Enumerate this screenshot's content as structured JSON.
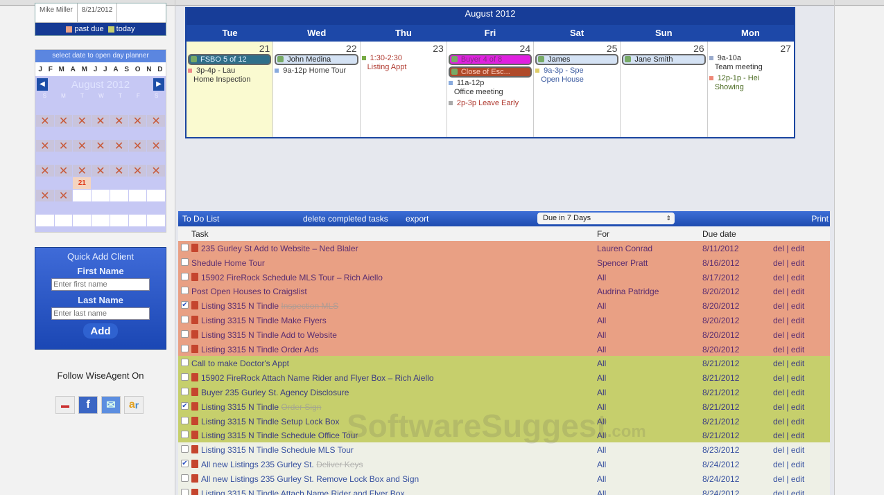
{
  "top_legend": {
    "user": "Mike Miller",
    "date": "8/21/2012",
    "past_due": "past due",
    "today": "today"
  },
  "mini_calendar": {
    "header": "select date to open day planner",
    "months": [
      "J",
      "F",
      "M",
      "A",
      "M",
      "J",
      "J",
      "A",
      "S",
      "O",
      "N",
      "D"
    ],
    "title": "August 2012",
    "dow": [
      "S",
      "M",
      "T",
      "W",
      "T",
      "F",
      "S"
    ],
    "today": "21"
  },
  "quick_add": {
    "title": "Quick Add Client",
    "first_label": "First Name",
    "first_placeholder": "Enter first name",
    "last_label": "Last Name",
    "last_placeholder": "Enter last name",
    "add": "Add"
  },
  "follow": {
    "label": "Follow WiseAgent On",
    "icons": [
      "youtube-icon",
      "facebook-icon",
      "twitter-icon",
      "activerain-icon"
    ]
  },
  "calendar": {
    "title": "August 2012",
    "days": [
      {
        "name": "Tue",
        "num": "21",
        "today": true,
        "pills": [
          {
            "text": "FSBO 5 of 12",
            "bg": "#2f6f8a",
            "fg": "#e0f0ff"
          }
        ],
        "events": [
          {
            "time": "3p-4p - Lau",
            "desc": "Home Inspection",
            "color": "#e88"
          }
        ]
      },
      {
        "name": "Wed",
        "num": "22",
        "pills": [
          {
            "text": "John Medina",
            "bg": "#d4e2f4",
            "fg": "#222"
          }
        ],
        "events": [
          {
            "time": "9a-12p Home Tour",
            "desc": "",
            "color": "#8ad"
          }
        ]
      },
      {
        "name": "Thu",
        "num": "23",
        "pills": [],
        "events": [
          {
            "time": "1:30-2:30",
            "desc": "Listing Appt",
            "color": "#7a4",
            "red": true
          }
        ]
      },
      {
        "name": "Fri",
        "num": "24",
        "pills": [
          {
            "text": "Buyer 4 of 8",
            "bg": "#e020e0",
            "fg": "#803080"
          },
          {
            "text": "Close of Esc...",
            "bg": "#b04a2a",
            "fg": "#ffd0c0"
          }
        ],
        "events": [
          {
            "time": "11a-12p",
            "desc": "Office meeting",
            "color": "#8ad"
          },
          {
            "time": "2p-3p Leave Early",
            "desc": "",
            "color": "#aaa",
            "red": true
          }
        ]
      },
      {
        "name": "Sat",
        "num": "25",
        "pills": [
          {
            "text": "James",
            "bg": "#d4e2f4",
            "fg": "#222"
          }
        ],
        "events": [
          {
            "time": "9a-3p - Spe",
            "desc": "Open House",
            "color": "#dc6",
            "blue": true
          }
        ]
      },
      {
        "name": "Sun",
        "num": "26",
        "pills": [
          {
            "text": "Jane Smith",
            "bg": "#d4e2f4",
            "fg": "#222"
          }
        ],
        "events": []
      },
      {
        "name": "Mon",
        "num": "27",
        "pills": [],
        "events": [
          {
            "time": "9a-10a",
            "desc": "Team meeting",
            "color": "#9ac"
          },
          {
            "time": "12p-1p - Hei",
            "desc": "Showing",
            "color": "#e87",
            "green": true
          }
        ]
      }
    ]
  },
  "todo": {
    "title": "To Do List",
    "delete_completed": "delete completed tasks",
    "export": "export",
    "filter": "Due in 7 Days",
    "print": "Print",
    "columns": {
      "task": "Task",
      "for": "For",
      "due": "Due date"
    },
    "del": "del",
    "edit": "edit",
    "rows": [
      {
        "c": "o",
        "task": "235 Gurley St Add to Website – Ned Blaler",
        "for": "Lauren Conrad",
        "due": "8/11/2012",
        "icon": true
      },
      {
        "c": "o",
        "task": "Shedule Home Tour",
        "for": "Spencer Pratt",
        "due": "8/16/2012"
      },
      {
        "c": "o",
        "task": "15902 FireRock Schedule MLS Tour – Rich Aiello",
        "for": "All",
        "due": "8/17/2012",
        "icon": true
      },
      {
        "c": "o",
        "task": "Post Open Houses to Craigslist",
        "for": "Audrina Patridge",
        "due": "8/20/2012"
      },
      {
        "c": "o",
        "task": "Listing 3315 N Tindle",
        "done": "Inspection MLS",
        "checked": true,
        "for": "All",
        "due": "8/20/2012",
        "icon": true
      },
      {
        "c": "o",
        "task": "Listing 3315 N Tindle Make Flyers",
        "for": "All",
        "due": "8/20/2012",
        "icon": true
      },
      {
        "c": "o",
        "task": "Listing 3315 N Tindle Add to Website",
        "for": "All",
        "due": "8/20/2012",
        "icon": true
      },
      {
        "c": "o",
        "task": "Listing 3315 N Tindle Order Ads",
        "for": "All",
        "due": "8/20/2012",
        "icon": true
      },
      {
        "c": "g",
        "task": "Call to make Doctor's Appt",
        "for": "All",
        "due": "8/21/2012"
      },
      {
        "c": "g",
        "task": "15902 FireRock Attach Name Rider and Flyer Box – Rich Aiello",
        "for": "All",
        "due": "8/21/2012",
        "icon": true
      },
      {
        "c": "g",
        "task": "Buyer 235 Gurley St. Agency Disclosure",
        "for": "All",
        "due": "8/21/2012",
        "icon": true
      },
      {
        "c": "g",
        "task": "Listing 3315 N Tindle",
        "done": "Order Sign",
        "checked": true,
        "for": "All",
        "due": "8/21/2012",
        "icon": true
      },
      {
        "c": "g",
        "task": "Listing 3315 N Tindle Setup Lock Box",
        "for": "All",
        "due": "8/21/2012",
        "icon": true
      },
      {
        "c": "g",
        "task": "Listing 3315 N Tindle Schedule Office Tour",
        "for": "All",
        "due": "8/21/2012",
        "icon": true
      },
      {
        "c": "n",
        "task": "Listing 3315 N Tindle Schedule MLS Tour",
        "for": "All",
        "due": "8/23/2012",
        "icon": true
      },
      {
        "c": "n",
        "task": "All new Listings 235 Gurley St.",
        "done": "Deliver Keys",
        "checked": true,
        "for": "All",
        "due": "8/24/2012",
        "icon": true
      },
      {
        "c": "n",
        "task": "All new Listings 235 Gurley St. Remove Lock Box and Sign",
        "for": "All",
        "due": "8/24/2012",
        "icon": true
      },
      {
        "c": "n",
        "task": "Listing 3315 N Tindle Attach Name Rider and Flyer Box",
        "for": "All",
        "due": "8/24/2012",
        "icon": true
      }
    ]
  },
  "watermark": "SoftwareSuggest.com",
  "colors": {
    "past_due": "#e9a084",
    "today": "#c6cf6c",
    "brand": "#1d48a8"
  }
}
